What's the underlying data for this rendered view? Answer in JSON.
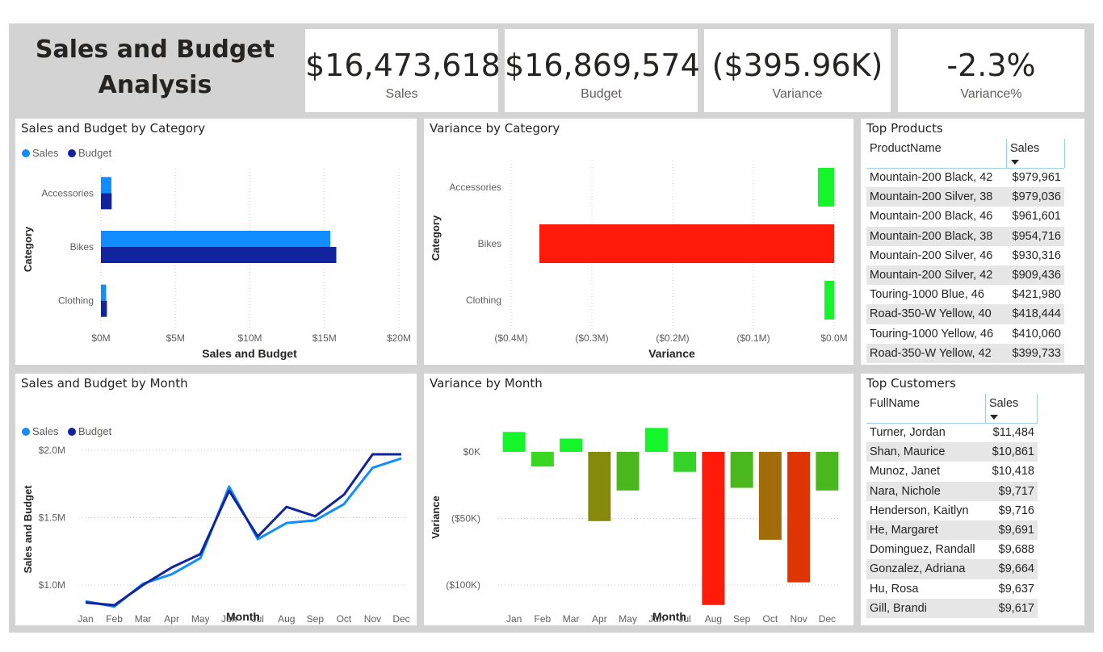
{
  "title_line1": "Sales and Budget",
  "title_line2": "Analysis",
  "kpis": [
    {
      "value": "$16,473,618",
      "label": "Sales"
    },
    {
      "value": "$16,869,574",
      "label": "Budget"
    },
    {
      "value": "($395.96K)",
      "label": "Variance"
    },
    {
      "value": "-2.3%",
      "label": "Variance%"
    }
  ],
  "colors": {
    "sales": "#118dff",
    "budget": "#12239e",
    "positive": "#14f52a"
  },
  "chart_data": [
    {
      "type": "bar",
      "title": "Sales and Budget by Category",
      "legend": [
        "Sales",
        "Budget"
      ],
      "legend_position": "top-left",
      "categories": [
        "Accessories",
        "Bikes",
        "Clothing"
      ],
      "series": [
        {
          "name": "Sales",
          "values": [
            0.7,
            15.4,
            0.35
          ]
        },
        {
          "name": "Budget",
          "values": [
            0.72,
            15.8,
            0.4
          ]
        }
      ],
      "unit": "M",
      "xlabel": "Sales and Budget",
      "ylabel": "Category",
      "xticks": [
        "$0M",
        "$5M",
        "$10M",
        "$15M",
        "$20M"
      ],
      "xlim": [
        0,
        20
      ],
      "grid": true
    },
    {
      "type": "bar",
      "title": "Variance by Category",
      "categories": [
        "Accessories",
        "Bikes",
        "Clothing"
      ],
      "values": [
        -0.02,
        -0.365,
        -0.012
      ],
      "unit": "M",
      "bar_colors": [
        "#14f52a",
        "#ff1a0a",
        "#14f52a"
      ],
      "xlabel": "Variance",
      "ylabel": "Category",
      "xticks": [
        "($0.4M)",
        "($0.3M)",
        "($0.2M)",
        "($0.1M)",
        "$0.0M"
      ],
      "xlim": [
        -0.4,
        0
      ],
      "grid": true
    },
    {
      "type": "line",
      "title": "Sales and Budget by Month",
      "legend": [
        "Sales",
        "Budget"
      ],
      "legend_position": "top-left",
      "categories": [
        "Jan",
        "Feb",
        "Mar",
        "Apr",
        "May",
        "Jun",
        "Jul",
        "Aug",
        "Sep",
        "Oct",
        "Nov",
        "Dec"
      ],
      "series": [
        {
          "name": "Sales",
          "values": [
            0.88,
            0.84,
            1.01,
            1.08,
            1.2,
            1.73,
            1.34,
            1.46,
            1.48,
            1.6,
            1.87,
            1.94
          ]
        },
        {
          "name": "Budget",
          "values": [
            0.87,
            0.85,
            1.0,
            1.13,
            1.23,
            1.7,
            1.36,
            1.58,
            1.51,
            1.67,
            1.97,
            1.97
          ]
        }
      ],
      "unit": "M",
      "xlabel": "Month",
      "ylabel": "Sales and Budget",
      "yticks": [
        "$1.0M",
        "$1.5M",
        "$2.0M"
      ],
      "ylim": [
        0.8,
        2.05
      ],
      "grid": true
    },
    {
      "type": "bar",
      "title": "Variance by Month",
      "categories": [
        "Jan",
        "Feb",
        "Mar",
        "Apr",
        "May",
        "Jun",
        "Jul",
        "Aug",
        "Sep",
        "Oct",
        "Nov",
        "Dec"
      ],
      "values": [
        15,
        -11,
        10,
        -52,
        -29,
        18,
        -15,
        -115,
        -27,
        -66,
        -98,
        -29
      ],
      "unit": "K",
      "bar_colors": [
        "#14f52a",
        "#39d71f",
        "#14f52a",
        "#868a0c",
        "#4bb71e",
        "#14f52a",
        "#35d22a",
        "#ff1a0a",
        "#4bb71e",
        "#a36c0b",
        "#df3504",
        "#4bb71e"
      ],
      "xlabel": "Month",
      "ylabel": "Variance",
      "yticks": [
        "$0K",
        "($50K)",
        "($100K)"
      ],
      "ylim": [
        -120,
        20
      ],
      "grid": true
    },
    {
      "type": "table",
      "title": "Top Products",
      "columns": [
        "ProductName",
        "Sales"
      ],
      "rows": [
        [
          "Mountain-200 Black, 42",
          "$979,961"
        ],
        [
          "Mountain-200 Silver, 38",
          "$979,036"
        ],
        [
          "Mountain-200 Black, 46",
          "$961,601"
        ],
        [
          "Mountain-200 Black, 38",
          "$954,716"
        ],
        [
          "Mountain-200 Silver, 46",
          "$930,316"
        ],
        [
          "Mountain-200 Silver, 42",
          "$909,436"
        ],
        [
          "Touring-1000 Blue, 46",
          "$421,980"
        ],
        [
          "Road-350-W Yellow, 40",
          "$418,444"
        ],
        [
          "Touring-1000 Yellow, 46",
          "$410,060"
        ],
        [
          "Road-350-W Yellow, 42",
          "$399,733"
        ]
      ]
    },
    {
      "type": "table",
      "title": "Top Customers",
      "columns": [
        "FullName",
        "Sales"
      ],
      "rows": [
        [
          "Turner, Jordan",
          "$11,484"
        ],
        [
          "Shan, Maurice",
          "$10,861"
        ],
        [
          "Munoz, Janet",
          "$10,418"
        ],
        [
          "Nara, Nichole",
          "$9,717"
        ],
        [
          "Henderson, Kaitlyn",
          "$9,716"
        ],
        [
          "He, Margaret",
          "$9,691"
        ],
        [
          "Dominguez, Randall",
          "$9,688"
        ],
        [
          "Gonzalez, Adriana",
          "$9,664"
        ],
        [
          "Hu, Rosa",
          "$9,637"
        ],
        [
          "Gill, Brandi",
          "$9,617"
        ]
      ]
    }
  ]
}
